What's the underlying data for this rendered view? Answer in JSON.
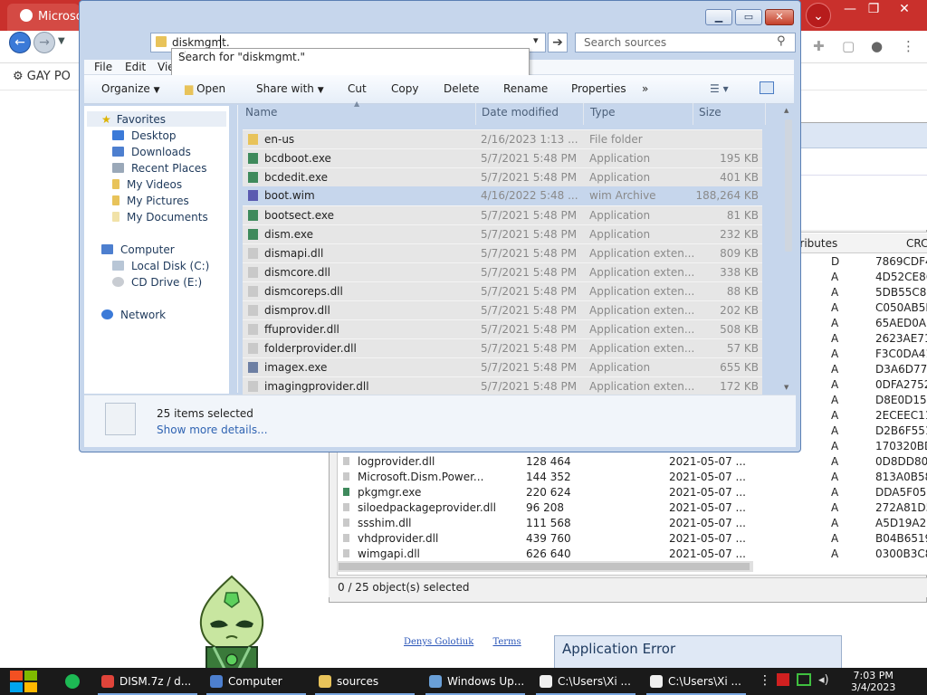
{
  "chrome": {
    "tab_title": "Microso",
    "bookmark_text": "GAY PO"
  },
  "zip_panel": {
    "header_attr": "ttributes",
    "header_crc": "CRC",
    "rows_right": [
      {
        "attr": "D",
        "crc": "7869CDF4"
      },
      {
        "attr": "A",
        "crc": "4D52CE86"
      },
      {
        "attr": "A",
        "crc": "5DB55C8E"
      },
      {
        "attr": "A",
        "crc": "C050AB5E"
      },
      {
        "attr": "A",
        "crc": "65AED0A7"
      },
      {
        "attr": "A",
        "crc": "2623AE71"
      },
      {
        "attr": "A",
        "crc": "F3C0DA41"
      },
      {
        "attr": "A",
        "crc": "D3A6D775"
      },
      {
        "attr": "A",
        "crc": "0DFA2752"
      },
      {
        "attr": "A",
        "crc": "D8E0D15F"
      },
      {
        "attr": "A",
        "crc": "2ECEEC11"
      },
      {
        "attr": "A",
        "crc": "D2B6F551"
      },
      {
        "attr": "A",
        "crc": "170320BD"
      }
    ],
    "rows": [
      {
        "name": "logprovider.dll",
        "size": "128 464",
        "date": "2021-05-07 ...",
        "attr": "A",
        "crc": "0D8DD803"
      },
      {
        "name": "Microsoft.Dism.Power...",
        "size": "144 352",
        "date": "2021-05-07 ...",
        "attr": "A",
        "crc": "813A0B58"
      },
      {
        "name": "pkgmgr.exe",
        "size": "220 624",
        "date": "2021-05-07 ...",
        "attr": "A",
        "crc": "DDA5F051"
      },
      {
        "name": "siloedpackageprovider.dll",
        "size": "96 208",
        "date": "2021-05-07 ...",
        "attr": "A",
        "crc": "272A81D5"
      },
      {
        "name": "ssshim.dll",
        "size": "111 568",
        "date": "2021-05-07 ...",
        "attr": "A",
        "crc": "A5D19A27"
      },
      {
        "name": "vhdprovider.dll",
        "size": "439 760",
        "date": "2021-05-07 ...",
        "attr": "A",
        "crc": "B04B6519"
      },
      {
        "name": "wimgapi.dll",
        "size": "626 640",
        "date": "2021-05-07 ...",
        "attr": "A",
        "crc": "0300B3C8"
      }
    ],
    "status": "0 / 25 object(s) selected"
  },
  "footer": {
    "author": "Denys Golotiuk",
    "terms": "Terms",
    "app_error": "Application Error"
  },
  "explorer": {
    "address": "diskmgmt.",
    "suggestion": "Search for \"diskmgmt.\"",
    "search_placeholder": "Search sources",
    "menu": [
      "File",
      "Edit",
      "Vie"
    ],
    "toolbar": {
      "organize": "Organize",
      "open": "Open",
      "share": "Share with",
      "cut": "Cut",
      "copy": "Copy",
      "delete": "Delete",
      "rename": "Rename",
      "properties": "Properties",
      "more": "»"
    },
    "nav": {
      "favorites": "Favorites",
      "desktop": "Desktop",
      "downloads": "Downloads",
      "recent": "Recent Places",
      "videos": "My Videos",
      "pictures": "My Pictures",
      "documents": "My Documents",
      "computer": "Computer",
      "local_disk": "Local Disk (C:)",
      "cd_drive": "CD Drive (E:)",
      "network": "Network"
    },
    "columns": {
      "name": "Name",
      "date": "Date modified",
      "type": "Type",
      "size": "Size"
    },
    "files": [
      {
        "name": "en-us",
        "date": "2/16/2023 1:13 ...",
        "type": "File folder",
        "size": "",
        "sel": true,
        "icon": "#e8c35a"
      },
      {
        "name": "bcdboot.exe",
        "date": "5/7/2021 5:48 PM",
        "type": "Application",
        "size": "195 KB",
        "sel": true,
        "icon": "#3f8a5c"
      },
      {
        "name": "bcdedit.exe",
        "date": "5/7/2021 5:48 PM",
        "type": "Application",
        "size": "401 KB",
        "sel": true,
        "icon": "#3f8a5c"
      },
      {
        "name": "boot.wim",
        "date": "4/16/2022 5:48 ...",
        "type": "wim Archive",
        "size": "188,264 KB",
        "sel": false,
        "icon": "#5a5ab0"
      },
      {
        "name": "bootsect.exe",
        "date": "5/7/2021 5:48 PM",
        "type": "Application",
        "size": "81 KB",
        "sel": true,
        "icon": "#3f8a5c"
      },
      {
        "name": "dism.exe",
        "date": "5/7/2021 5:48 PM",
        "type": "Application",
        "size": "232 KB",
        "sel": true,
        "icon": "#3f8a5c"
      },
      {
        "name": "dismapi.dll",
        "date": "5/7/2021 5:48 PM",
        "type": "Application exten...",
        "size": "809 KB",
        "sel": true,
        "icon": "#c9c9c9"
      },
      {
        "name": "dismcore.dll",
        "date": "5/7/2021 5:48 PM",
        "type": "Application exten...",
        "size": "338 KB",
        "sel": true,
        "icon": "#c9c9c9"
      },
      {
        "name": "dismcoreps.dll",
        "date": "5/7/2021 5:48 PM",
        "type": "Application exten...",
        "size": "88 KB",
        "sel": true,
        "icon": "#c9c9c9"
      },
      {
        "name": "dismprov.dll",
        "date": "5/7/2021 5:48 PM",
        "type": "Application exten...",
        "size": "202 KB",
        "sel": true,
        "icon": "#c9c9c9"
      },
      {
        "name": "ffuprovider.dll",
        "date": "5/7/2021 5:48 PM",
        "type": "Application exten...",
        "size": "508 KB",
        "sel": true,
        "icon": "#c9c9c9"
      },
      {
        "name": "folderprovider.dll",
        "date": "5/7/2021 5:48 PM",
        "type": "Application exten...",
        "size": "57 KB",
        "sel": true,
        "icon": "#c9c9c9"
      },
      {
        "name": "imagex.exe",
        "date": "5/7/2021 5:48 PM",
        "type": "Application",
        "size": "655 KB",
        "sel": true,
        "icon": "#6d7fa3"
      },
      {
        "name": "imagingprovider.dll",
        "date": "5/7/2021 5:48 PM",
        "type": "Application exten...",
        "size": "172 KB",
        "sel": true,
        "icon": "#c9c9c9"
      }
    ],
    "details_count": "25 items selected",
    "details_more": "Show more details..."
  },
  "taskbar": {
    "items": [
      {
        "label": "DISM.7z / d...",
        "color": "#e0443a"
      },
      {
        "label": "Computer",
        "color": "#4d7fcf"
      },
      {
        "label": "sources",
        "color": "#e8c35a"
      },
      {
        "label": "Windows Up...",
        "color": "#6aa0d8"
      },
      {
        "label": "C:\\Users\\Xi ...",
        "color": "#f0f0f0"
      },
      {
        "label": "C:\\Users\\Xi ...",
        "color": "#f0f0f0"
      }
    ],
    "time": "7:03 PM",
    "date": "3/4/2023"
  }
}
